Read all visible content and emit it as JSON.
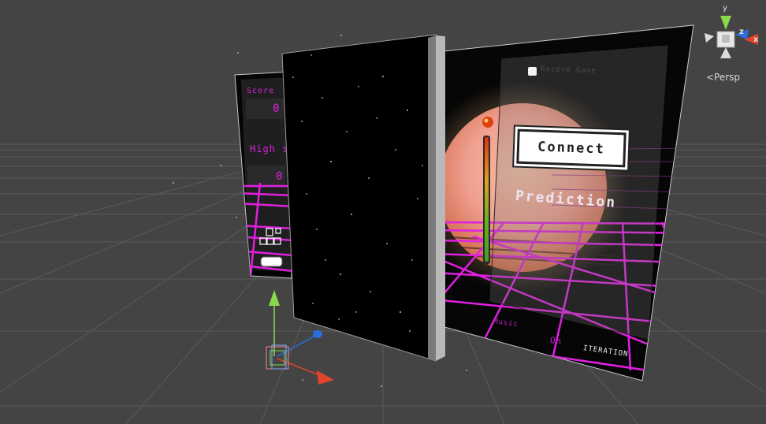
{
  "viewport": {
    "projection_label": "<Persp"
  },
  "axes": {
    "y": "y",
    "z": "z",
    "x": "x"
  },
  "left_panel": {
    "score_label": "Score",
    "score_value": "0",
    "high_score_label": "High sc",
    "high_score_value": "0"
  },
  "right_panel": {
    "record_label": "Record Game",
    "connect_label": "Connect",
    "prediction_label": "Prediction",
    "music_label": "Music",
    "music_value": "On",
    "iteration_label": "ITERATION"
  },
  "colors": {
    "background": "#444444",
    "neon": "#e020e0",
    "sun": "#f0a890",
    "axis_y": "#8ad94a",
    "axis_x": "#e0442a",
    "axis_z": "#2c6de0"
  }
}
